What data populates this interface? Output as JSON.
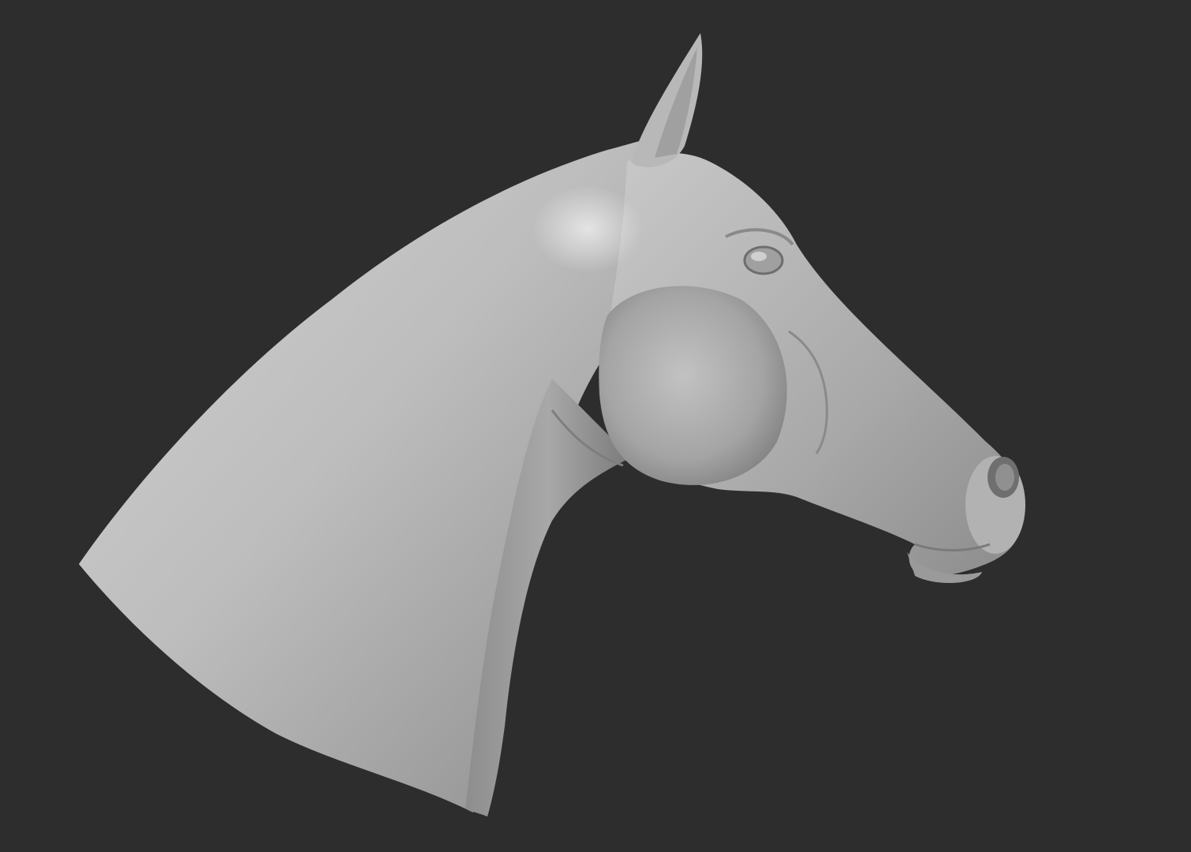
{
  "scene": {
    "subject": "horse-head-sculpt",
    "background_color": "#2d2d2d",
    "material_color": "#b4b4b4",
    "highlight_color": "#e6e6e6",
    "shadow_color": "#6e6e6e"
  }
}
